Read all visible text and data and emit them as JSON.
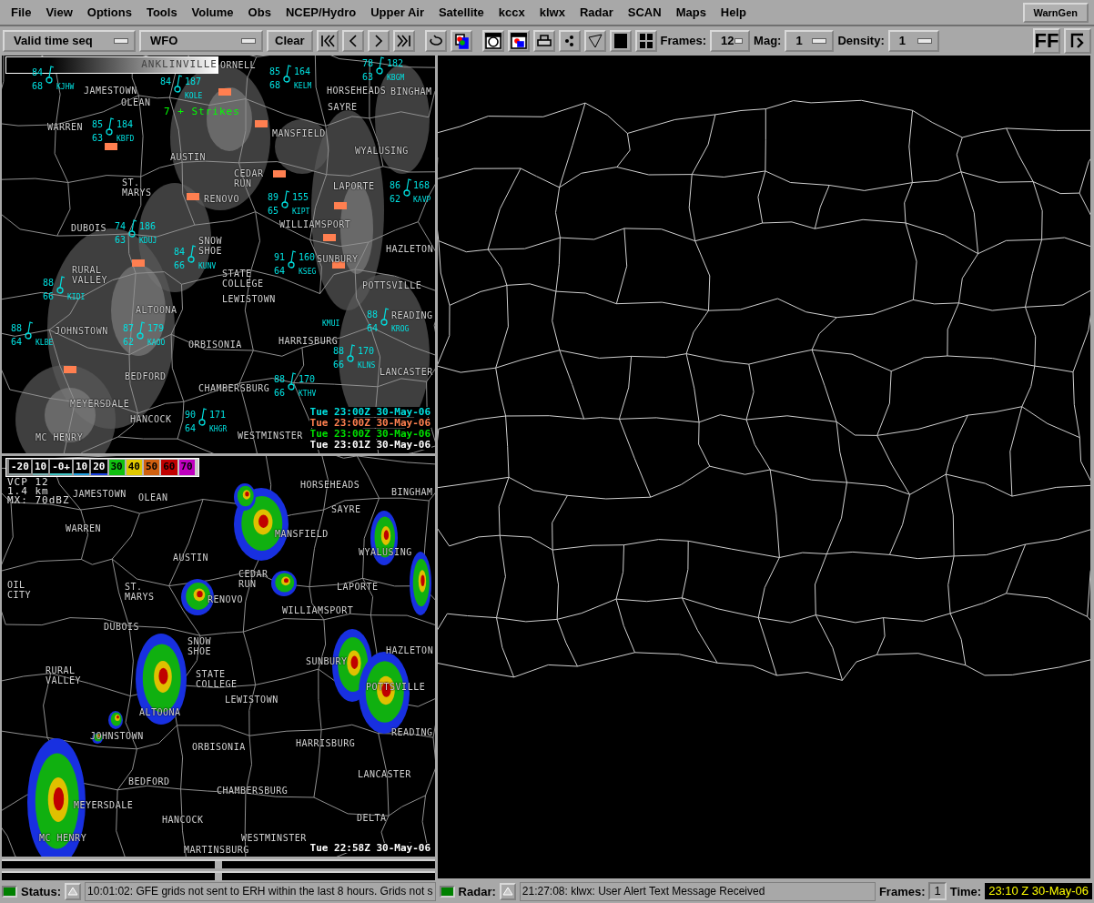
{
  "menu": [
    "File",
    "View",
    "Options",
    "Tools",
    "Volume",
    "Obs",
    "NCEP/Hydro",
    "Upper Air",
    "Satellite",
    "kccx",
    "klwx",
    "Radar",
    "SCAN",
    "Maps",
    "Help"
  ],
  "warngen": "WarnGen",
  "toolbar": {
    "load_mode": "Valid time seq",
    "scale": "WFO",
    "clear": "Clear",
    "frames_label": "Frames:",
    "frames": "12",
    "mag_label": "Mag:",
    "mag": "1",
    "density_label": "Density:",
    "density": "1",
    "ff": "FF"
  },
  "top_panel": {
    "legend_text": "ANKLINVILLE",
    "lightning": "7 + Strikes",
    "towns": [
      "ORNELL",
      "JAMESTOWN",
      "OLEAN",
      "HORSEHEADS",
      "BINGHAM",
      "SAYRE",
      "WARREN",
      "MANSFIELD",
      "AUSTIN",
      "WYALUSING",
      "CEDAR\nRUN",
      "ST.\nMARYS",
      "LAPORTE",
      "RENOVO",
      "WILLIAMSPORT",
      "DUBOIS",
      "SNOW\nSHOE",
      "HAZLETON",
      "SUNBURY",
      "RURAL\nVALLEY",
      "STATE\nCOLLEGE",
      "POTTSVILLE",
      "LEWISTOWN",
      "ALTOONA",
      "JOHNSTOWN",
      "ORBISONIA",
      "HARRISBURG",
      "READING",
      "LANCASTER",
      "BEDFORD",
      "CHAMBERSBURG",
      "MEYERSDALE",
      "HANCOCK",
      "MC HENRY",
      "WESTMINSTER"
    ],
    "stations": [
      {
        "temp": "84",
        "dew": "68",
        "id": "KJHW"
      },
      {
        "temp": "84",
        "pressure": "187",
        "id": "KOLE"
      },
      {
        "temp": "85",
        "dew": "68",
        "pressure": "164",
        "id": "KELM"
      },
      {
        "temp": "78",
        "dew": "63",
        "pressure": "182",
        "id": "KBGM"
      },
      {
        "temp": "85",
        "dew": "63",
        "pressure": "184",
        "id": "KBFD"
      },
      {
        "temp": "86",
        "dew": "62",
        "pressure": "168",
        "id": "KAVP"
      },
      {
        "temp": "89",
        "dew": "65",
        "pressure": "155",
        "id": "KIPT"
      },
      {
        "temp": "74",
        "dew": "63",
        "pressure": "186",
        "id": "KDUJ"
      },
      {
        "temp": "84",
        "dew": "66",
        "id": "KUNV"
      },
      {
        "temp": "91",
        "dew": "64",
        "pressure": "160",
        "id": "KSEG"
      },
      {
        "temp": "88",
        "dew": "66",
        "id": "KIDI"
      },
      {
        "temp": "88",
        "dew": "64",
        "id": "KLBE"
      },
      {
        "temp": "87",
        "dew": "62",
        "pressure": "179",
        "id": "KAOO"
      },
      {
        "temp": "88",
        "dew": "64",
        "id": "KROG"
      },
      {
        "temp": "88",
        "dew": "66",
        "pressure": "170",
        "id": "KLNS"
      },
      {
        "temp": "88",
        "dew": "66",
        "pressure": "170",
        "id": "KTHV"
      },
      {
        "temp": "90",
        "dew": "64",
        "pressure": "171",
        "id": "KHGR"
      }
    ],
    "extra_ids": [
      "KMUI"
    ],
    "timestamps": [
      {
        "text": "Tue 23:00Z 30-May-06",
        "color": "#00e0e0"
      },
      {
        "text": "Tue 23:00Z 30-May-06",
        "color": "#ff8050"
      },
      {
        "text": "Tue 23:00Z 30-May-06",
        "color": "#00e000"
      },
      {
        "text": "Tue 23:01Z 30-May-06",
        "color": "#ffffff"
      }
    ]
  },
  "bottom_panel": {
    "legend": [
      {
        "label": "-20",
        "color": "#8c9c9c"
      },
      {
        "label": "10",
        "color": "#78b4b4"
      },
      {
        "label": "-0+",
        "color": "#40c4c4"
      },
      {
        "label": "10",
        "color": "#20a0e0"
      },
      {
        "label": "20",
        "color": "#1840e0"
      },
      {
        "label": "30",
        "color": "#10c010"
      },
      {
        "label": "40",
        "color": "#e0c800"
      },
      {
        "label": "50",
        "color": "#d06010"
      },
      {
        "label": "60",
        "color": "#c00000"
      },
      {
        "label": "70",
        "color": "#c000c0"
      }
    ],
    "radar_info": [
      "VCP 12",
      "1.4 km",
      "MX: 70dBZ"
    ],
    "towns": [
      "JAMESTOWN",
      "OLEAN",
      "HORSEHEADS",
      "BINGHAM",
      "SAYRE",
      "WARREN",
      "MANSFIELD",
      "WYALUSING",
      "AUSTIN",
      "CEDAR\nRUN",
      "OIL\nCITY",
      "ST.\nMARYS",
      "LAPORTE",
      "RENOVO",
      "WILLIAMSPORT",
      "DUBOIS",
      "SNOW\nSHOE",
      "HAZLETON",
      "SUNBURY",
      "RURAL\nVALLEY",
      "STATE\nCOLLEGE",
      "POTTSVILLE",
      "LEWISTOWN",
      "ALTOONA",
      "JOHNSTOWN",
      "READING",
      "ORBISONIA",
      "HARRISBURG",
      "BEDFORD",
      "LANCASTER",
      "CHAMBERSBURG",
      "MEYERSDALE",
      "DELTA",
      "HANCOCK",
      "MC HENRY",
      "WESTMINSTER",
      "MARTINSBURG"
    ],
    "timestamp": "Tue 22:58Z 30-May-06"
  },
  "status": {
    "status_label": "Status:",
    "status_message": "10:01:02: GFE grids not sent to ERH within the last 8 hours.  Grids not s",
    "radar_label": "Radar:",
    "radar_message": "21:27:08: klwx: User Alert Text Message Received",
    "frames_label": "Frames:",
    "frames": "1",
    "time_label": "Time:",
    "time": "23:10 Z 30-May-06"
  }
}
